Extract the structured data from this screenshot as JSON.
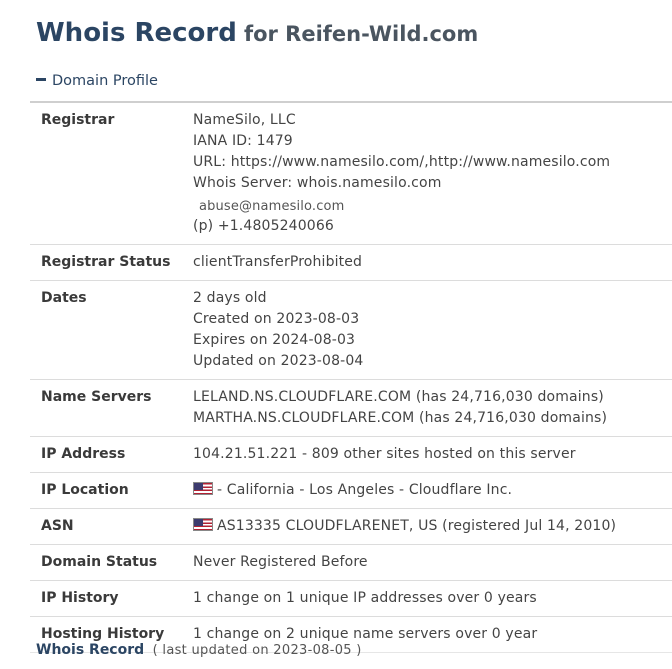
{
  "header": {
    "title_main": "Whois Record",
    "title_sub": "for Reifen-Wild.com"
  },
  "section": {
    "label": "Domain Profile",
    "toggle_icon": "minus-icon"
  },
  "rows": {
    "registrar": {
      "label": "Registrar",
      "name": "NameSilo, LLC",
      "iana": "IANA ID: 1479",
      "url": "URL: https://www.namesilo.com/,http://www.namesilo.com",
      "whois_server": "Whois Server: whois.namesilo.com",
      "email": "abuse@namesilo.com",
      "phone": "(p) +1.4805240066"
    },
    "registrar_status": {
      "label": "Registrar Status",
      "value": "clientTransferProhibited"
    },
    "dates": {
      "label": "Dates",
      "age": "2 days old",
      "created": "Created on 2023-08-03",
      "expires": "Expires on 2024-08-03",
      "updated": "Updated on 2023-08-04"
    },
    "name_servers": {
      "label": "Name Servers",
      "ns1": "LELAND.NS.CLOUDFLARE.COM (has 24,716,030 domains)",
      "ns2": "MARTHA.NS.CLOUDFLARE.COM (has 24,716,030 domains)"
    },
    "ip_address": {
      "label": "IP Address",
      "value": "104.21.51.221 - 809 other sites hosted on this server"
    },
    "ip_location": {
      "label": "IP Location",
      "flag_icon": "us-flag-icon",
      "value": "- California - Los Angeles - Cloudflare Inc."
    },
    "asn": {
      "label": "ASN",
      "flag_icon": "us-flag-icon",
      "value": "AS13335 CLOUDFLARENET, US (registered Jul 14, 2010)"
    },
    "domain_status": {
      "label": "Domain Status",
      "value": "Never Registered Before"
    },
    "ip_history": {
      "label": "IP History",
      "value": "1 change on 1 unique IP addresses over 0 years"
    },
    "hosting_history": {
      "label": "Hosting History",
      "value": "1 change on 2 unique name servers over 0 year"
    }
  },
  "footer": {
    "link": "Whois Record",
    "updated": "( last updated on 2023-08-05 )"
  }
}
